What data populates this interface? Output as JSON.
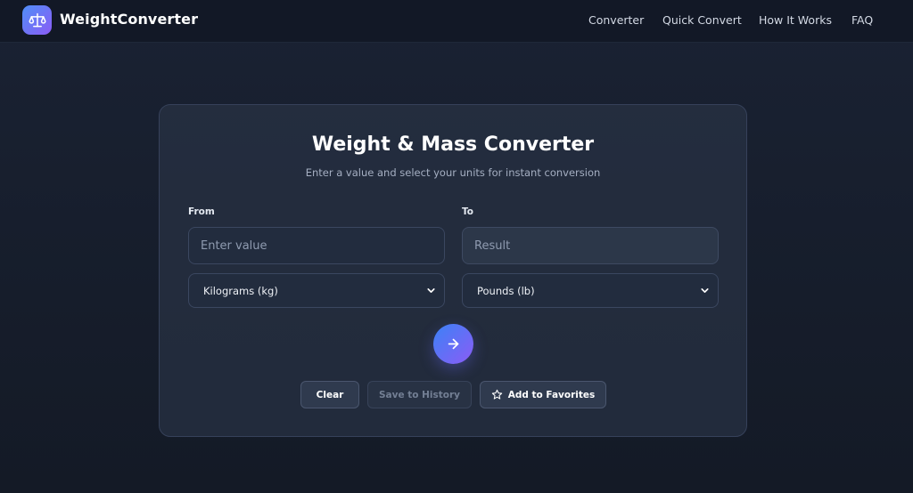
{
  "app": {
    "brand": "WeightConverter",
    "logo_icon": "scale-icon"
  },
  "nav": {
    "links": [
      {
        "label": "Converter"
      },
      {
        "label": "Quick Convert"
      },
      {
        "label": "How It Works"
      },
      {
        "label": "FAQ"
      }
    ]
  },
  "converter": {
    "title": "Weight & Mass Converter",
    "subtitle": "Enter a value and select your units for instant conversion",
    "from": {
      "label": "From",
      "input_value": "",
      "input_placeholder": "Enter value",
      "unit": "Kilograms (kg)"
    },
    "to": {
      "label": "To",
      "result_value": "",
      "result_placeholder": "Result",
      "unit": "Pounds (lb)"
    },
    "convert_icon": "arrow-right-icon",
    "actions": {
      "clear": "Clear",
      "save_history": "Save to History",
      "add_favorites": "Add to Favorites",
      "favorites_icon": "star-icon"
    }
  },
  "colors": {
    "background": "#161d2b",
    "card": "#28324a",
    "accent_start": "#3b82f6",
    "accent_end": "#8b5cf6"
  }
}
